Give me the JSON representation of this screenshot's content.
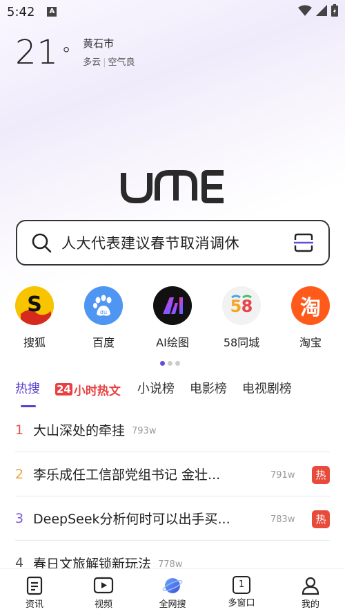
{
  "status_bar": {
    "time": "5:42",
    "notification_icon": "A"
  },
  "weather": {
    "temperature": "21",
    "degree": "°",
    "city": "黄石市",
    "condition": "多云",
    "air_quality": "空气良"
  },
  "logo": {
    "icon": "ume-logo"
  },
  "search": {
    "query": "人大代表建议春节取消调休",
    "icon": "search-icon",
    "scan_icon": "scan-icon"
  },
  "shortcuts": [
    {
      "label": "搜狐",
      "icon": "sohu-icon"
    },
    {
      "label": "百度",
      "icon": "baidu-icon"
    },
    {
      "label": "AI绘图",
      "icon": "ai-draw-icon"
    },
    {
      "label": "58同城",
      "icon": "58-icon"
    },
    {
      "label": "淘宝",
      "icon": "taobao-icon",
      "glyph": "淘"
    }
  ],
  "tabs": {
    "hot": "热搜",
    "hot24_num": "24",
    "hot24_text": "小时热文",
    "novel": "小说榜",
    "movie": "电影榜",
    "tv": "电视剧榜"
  },
  "hot_list": [
    {
      "rank": "1",
      "title": "大山深处的牵挂",
      "count": "793w",
      "badge": ""
    },
    {
      "rank": "2",
      "title": "李乐成任工信部党组书记 金壮...",
      "count": "791w",
      "badge": "热"
    },
    {
      "rank": "3",
      "title": "DeepSeek分析何时可以出手买...",
      "count": "783w",
      "badge": "热"
    },
    {
      "rank": "4",
      "title": "春日文旅解锁新玩法",
      "count": "778w",
      "badge": ""
    }
  ],
  "bottom_nav": [
    {
      "label": "资讯",
      "icon": "news-icon"
    },
    {
      "label": "视频",
      "icon": "video-icon"
    },
    {
      "label": "全网搜",
      "icon": "planet-icon"
    },
    {
      "label": "多窗口",
      "icon": "window-icon",
      "count": "1"
    },
    {
      "label": "我的",
      "icon": "profile-icon"
    }
  ],
  "colors": {
    "accent": "#5b3fd1",
    "hot": "#e84b3c",
    "rank1": "#e05252",
    "rank2": "#e8a23a",
    "rank3": "#7a5cd6"
  }
}
